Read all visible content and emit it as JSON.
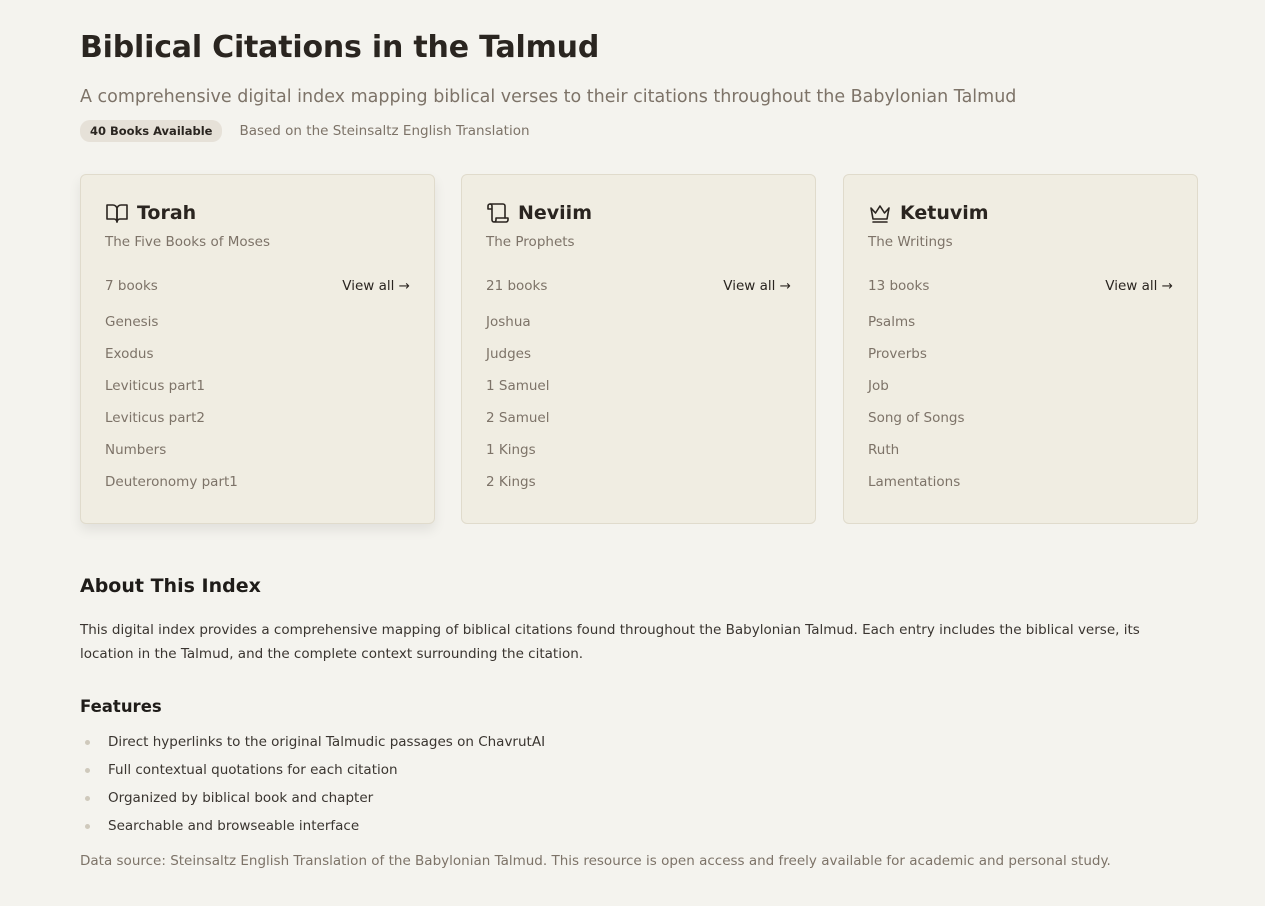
{
  "header": {
    "title": "Biblical Citations in the Talmud",
    "subtitle": "A comprehensive digital index mapping biblical verses to their citations throughout the Babylonian Talmud",
    "badge": "40 Books Available",
    "meta": "Based on the Steinsaltz English Translation"
  },
  "sections": [
    {
      "icon": "open-book-icon",
      "title": "Torah",
      "subtitle": "The Five Books of Moses",
      "count": "7 books",
      "view_all": "View all →",
      "books": [
        "Genesis",
        "Exodus",
        "Leviticus part1",
        "Leviticus part2",
        "Numbers",
        "Deuteronomy part1"
      ]
    },
    {
      "icon": "scroll-icon",
      "title": "Neviim",
      "subtitle": "The Prophets",
      "count": "21 books",
      "view_all": "View all →",
      "books": [
        "Joshua",
        "Judges",
        "1 Samuel",
        "2 Samuel",
        "1 Kings",
        "2 Kings"
      ]
    },
    {
      "icon": "crown-icon",
      "title": "Ketuvim",
      "subtitle": "The Writings",
      "count": "13 books",
      "view_all": "View all →",
      "books": [
        "Psalms",
        "Proverbs",
        "Job",
        "Song of Songs",
        "Ruth",
        "Lamentations"
      ]
    }
  ],
  "about": {
    "title": "About This Index",
    "text": "This digital index provides a comprehensive mapping of biblical citations found throughout the Babylonian Talmud. Each entry includes the biblical verse, its location in the Talmud, and the complete context surrounding the citation."
  },
  "features": {
    "title": "Features",
    "items": [
      "Direct hyperlinks to the original Talmudic passages on ChavrutAI",
      "Full contextual quotations for each citation",
      "Organized by biblical book and chapter",
      "Searchable and browseable interface"
    ]
  },
  "footer": {
    "text": "Data source: Steinsaltz English Translation of the Babylonian Talmud. This resource is open access and freely available for academic and personal study."
  },
  "colors": {
    "background": "#f4f3ee",
    "card": "#f0ede2",
    "heading": "#2a2520",
    "muted": "#7d7368"
  }
}
